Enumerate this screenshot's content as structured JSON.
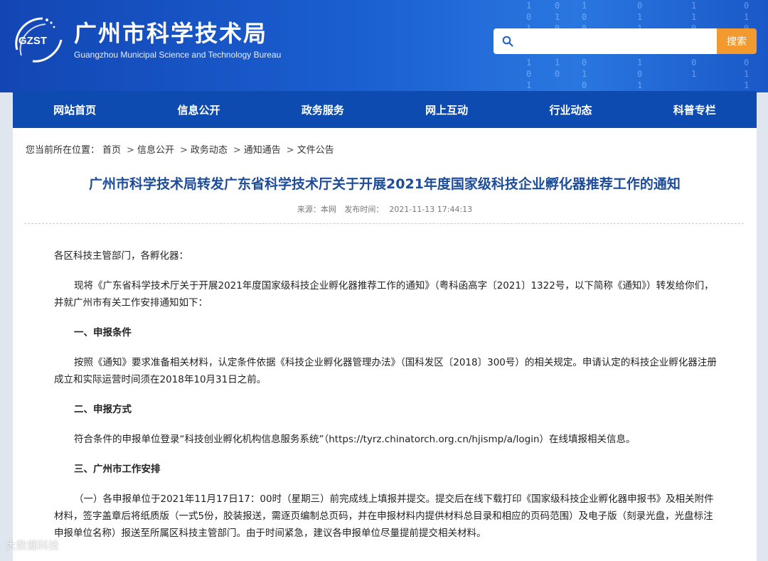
{
  "header": {
    "logo_abbr": "GZST",
    "site_name_cn": "广州市科学技术局",
    "site_name_en": "Guangzhou Municipal Science and Technology Bureau",
    "search_placeholder": "",
    "search_button": "搜索",
    "binary_columns": [
      "1\n0\n1\n1\n0\n1\n0\n1",
      "0\n1\n0\n0\n1\n1\n0",
      "1\n0\n0\n1\n1\n0\n1\n0",
      "0\n1\n1\n0\n0\n1\n0\n1",
      "1\n1\n0\n1\n0\n0\n1",
      "0\n1\n0\n0\n1\n0\n1\n1"
    ]
  },
  "nav": {
    "items": [
      "网站首页",
      "信息公开",
      "政务服务",
      "网上互动",
      "行业动态",
      "科普专栏"
    ]
  },
  "breadcrumb": {
    "prefix": "您当前所在位置：",
    "items": [
      "首页",
      "信息公开",
      "政务动态",
      "通知通告",
      "文件公告"
    ],
    "sep": ">"
  },
  "article": {
    "title": "广州市科学技术局转发广东省科学技术厅关于开展2021年度国家级科技企业孵化器推荐工作的通知",
    "source": "来源：本网",
    "publish_label": "发布时间：",
    "publish_time": "2021-11-13 17:44:13",
    "greeting": "各区科技主管部门，各孵化器：",
    "intro": "现将《广东省科学技术厅关于开展2021年度国家级科技企业孵化器推荐工作的通知》（粤科函高字〔2021〕1322号，以下简称《通知》）转发给你们，并就广州市有关工作安排通知如下：",
    "h1": "一、申报条件",
    "p1": "按照《通知》要求准备相关材料，认定条件依据《科技企业孵化器管理办法》（国科发区〔2018〕300号）的相关规定。申请认定的科技企业孵化器注册成立和实际运营时间须在2018年10月31日之前。",
    "h2": "二、申报方式",
    "p2": "符合条件的申报单位登录“科技创业孵化机构信息服务系统”（https://tyrz.chinatorch.org.cn/hjismp/a/login）在线填报相关信息。",
    "h3": "三、广州市工作安排",
    "p3": "（一）各申报单位于2021年11月17日17：00时（星期三）前完成线上填报并提交。提交后在线下载打印《国家级科技企业孵化器申报书》及相关附件材料，签字盖章后将纸质版（一式5份，胶装报送，需逐页编制总页码，并在申报材料内提供材料总目录和相应的页码范围）及电子版（刻录光盘，光盘标注申报单位名称）报送至所属区科技主管部门。由于时间紧急，建议各申报单位尽量提前提交相关材料。"
  },
  "watermark": "大数据科技"
}
